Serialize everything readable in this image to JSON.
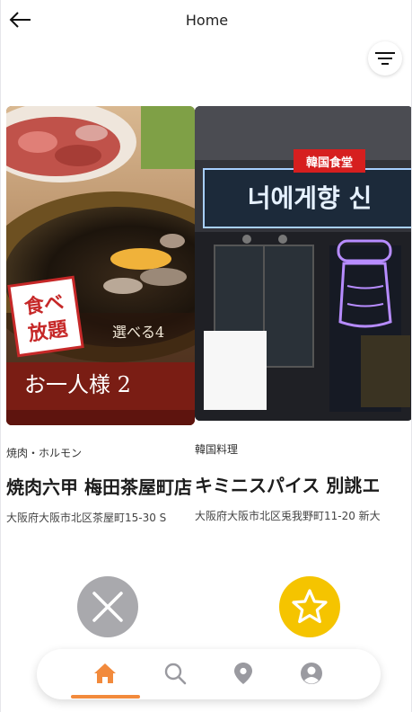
{
  "header": {
    "title": "Home",
    "back_icon": "arrow-left-icon",
    "filter_icon": "filter-lines-icon"
  },
  "cards": [
    {
      "category": "焼肉・ホルモン",
      "name": "焼肉六甲 梅田茶屋町店",
      "address": "大阪府大阪市北区茶屋町15-30 S",
      "photo_text": {
        "badge_line1": "食べ",
        "badge_line2": "放題",
        "banner1": "選べる4",
        "banner2": "お一人様 2"
      }
    },
    {
      "category": "韓国料理",
      "name": "キミニスパイス 別誂エ",
      "address": "大阪府大阪市北区兎我野町11-20 新大",
      "photo_text": {
        "sign_small": "韓国食堂",
        "sign_large": "너에게향 신"
      }
    }
  ],
  "actions": {
    "reject_icon": "close-x-icon",
    "favorite_icon": "star-icon"
  },
  "bottom_nav": {
    "items": [
      "home-icon",
      "search-icon",
      "map-pin-icon",
      "profile-icon"
    ],
    "active": "home-icon"
  },
  "colors": {
    "accent": "#f28a3c",
    "favorite": "#f5c400",
    "reject": "#a9a9ad",
    "nav_inactive": "#9a9aa0"
  }
}
